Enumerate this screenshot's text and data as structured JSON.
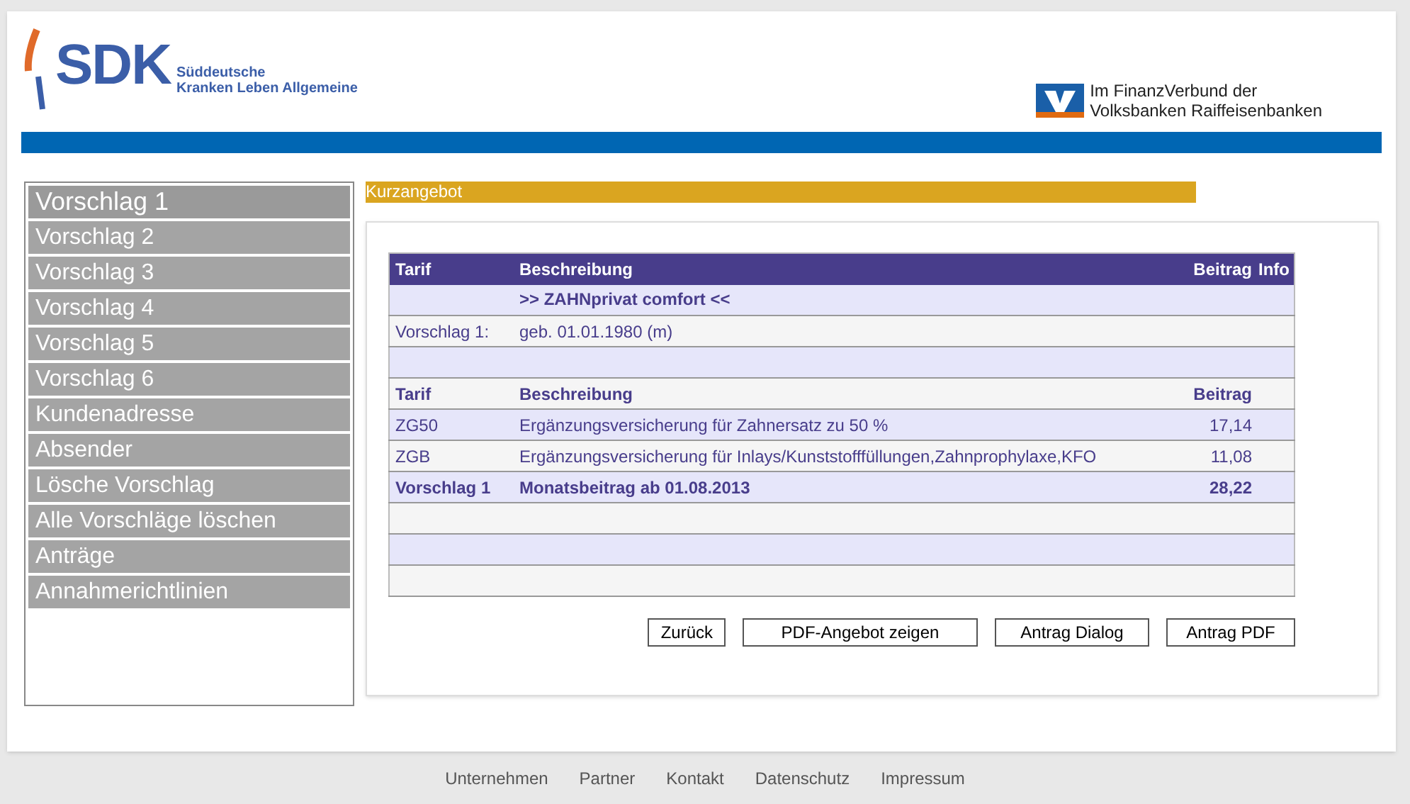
{
  "header": {
    "logo_text": "SDK",
    "logo_tagline": [
      "Süddeutsche",
      "Kranken Leben Allgemeine"
    ],
    "partner_text": [
      "Im FinanzVerbund der",
      "Volksbanken Raiffeisenbanken"
    ]
  },
  "sidebar": {
    "items": [
      {
        "label": "Vorschlag 1",
        "selected": true
      },
      {
        "label": "Vorschlag 2",
        "selected": false
      },
      {
        "label": "Vorschlag 3",
        "selected": false
      },
      {
        "label": "Vorschlag 4",
        "selected": false
      },
      {
        "label": "Vorschlag 5",
        "selected": false
      },
      {
        "label": "Vorschlag 6",
        "selected": false
      },
      {
        "label": "Kundenadresse",
        "selected": false
      },
      {
        "label": "Absender",
        "selected": false
      },
      {
        "label": "Lösche Vorschlag",
        "selected": false
      },
      {
        "label": "Alle Vorschläge löschen",
        "selected": false
      },
      {
        "label": "Anträge",
        "selected": false
      },
      {
        "label": "Annahmerichtlinien",
        "selected": false
      }
    ]
  },
  "section_title": "Kurzangebot",
  "table": {
    "columns": [
      "Tarif",
      "Beschreibung",
      "Beitrag",
      "Info"
    ],
    "rows": [
      {
        "kind": "product",
        "cells": [
          "",
          ">> ZAHNprivat comfort <<",
          ""
        ]
      },
      {
        "kind": "info",
        "cells": [
          "Vorschlag 1:",
          "geb. 01.01.1980 (m)",
          ""
        ]
      },
      {
        "kind": "empty",
        "cells": []
      },
      {
        "kind": "subheader",
        "cells": [
          "Tarif",
          "Beschreibung",
          "Beitrag"
        ]
      },
      {
        "kind": "item",
        "cells": [
          "ZG50",
          "Ergänzungsversicherung für Zahnersatz zu 50 %",
          "17,14"
        ]
      },
      {
        "kind": "item",
        "cells": [
          "ZGB",
          "Ergänzungsversicherung für Inlays/Kunststofffüllungen,Zahnprophylaxe,KFO",
          "11,08"
        ]
      },
      {
        "kind": "total",
        "cells": [
          "Vorschlag 1",
          "Monatsbeitrag ab 01.08.2013",
          "28,22"
        ]
      },
      {
        "kind": "empty",
        "cells": []
      },
      {
        "kind": "empty",
        "cells": []
      },
      {
        "kind": "empty",
        "cells": []
      }
    ]
  },
  "buttons": [
    "Zurück",
    "PDF-Angebot zeigen",
    "Antrag Dialog",
    "Antrag PDF"
  ],
  "footer_links": [
    "Unternehmen",
    "Partner",
    "Kontakt",
    "Datenschutz",
    "Impressum"
  ]
}
